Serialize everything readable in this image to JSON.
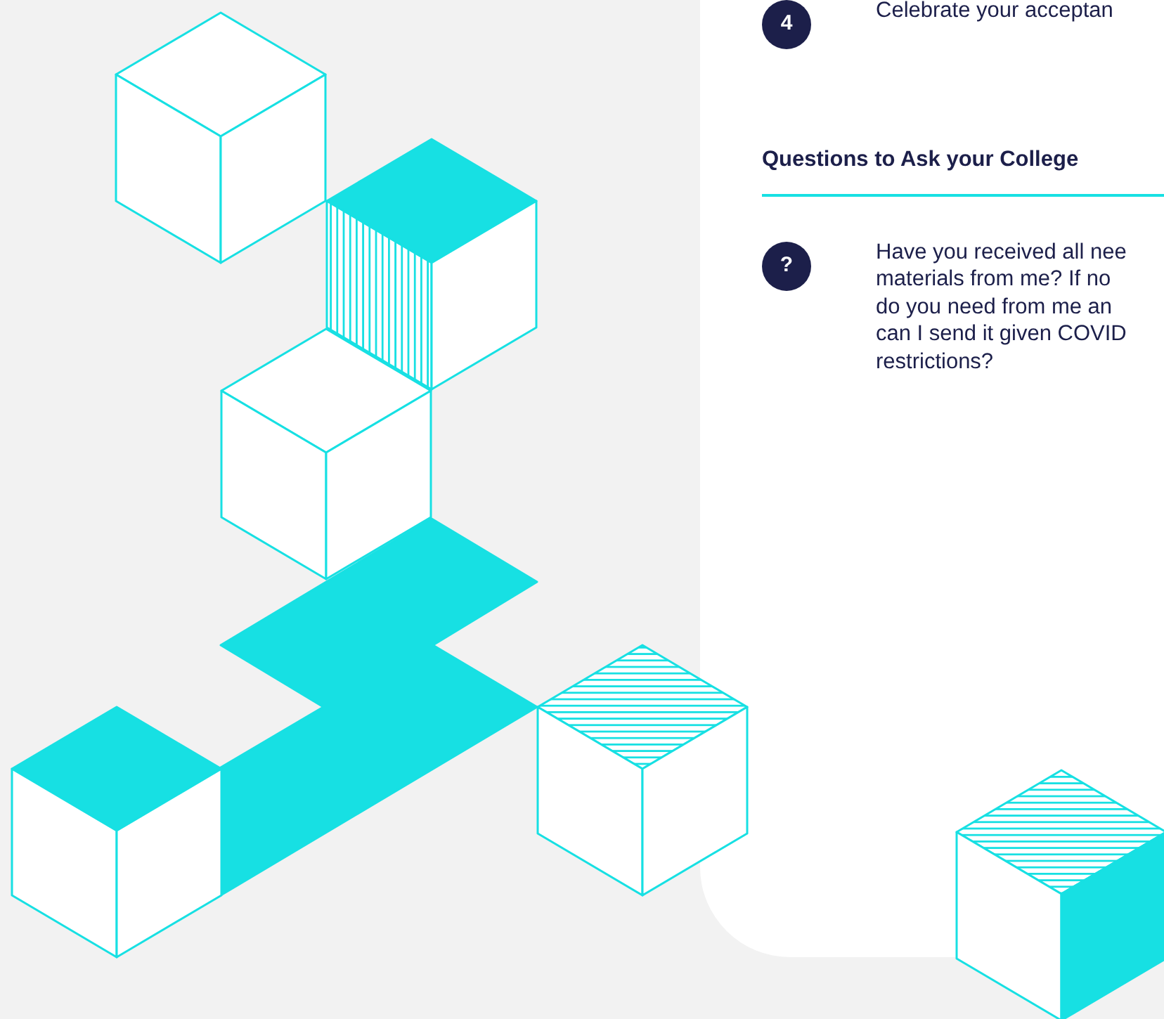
{
  "steps": [
    {
      "number": "4",
      "text": "Celebrate your acceptan"
    }
  ],
  "section": {
    "heading": "Questions to Ask your College"
  },
  "questions": [
    {
      "mark": "?",
      "lines": [
        "Have you received all nee",
        "materials from me? If no",
        "do you need from me an",
        "can I send it given COVID",
        "restrictions?"
      ]
    }
  ]
}
